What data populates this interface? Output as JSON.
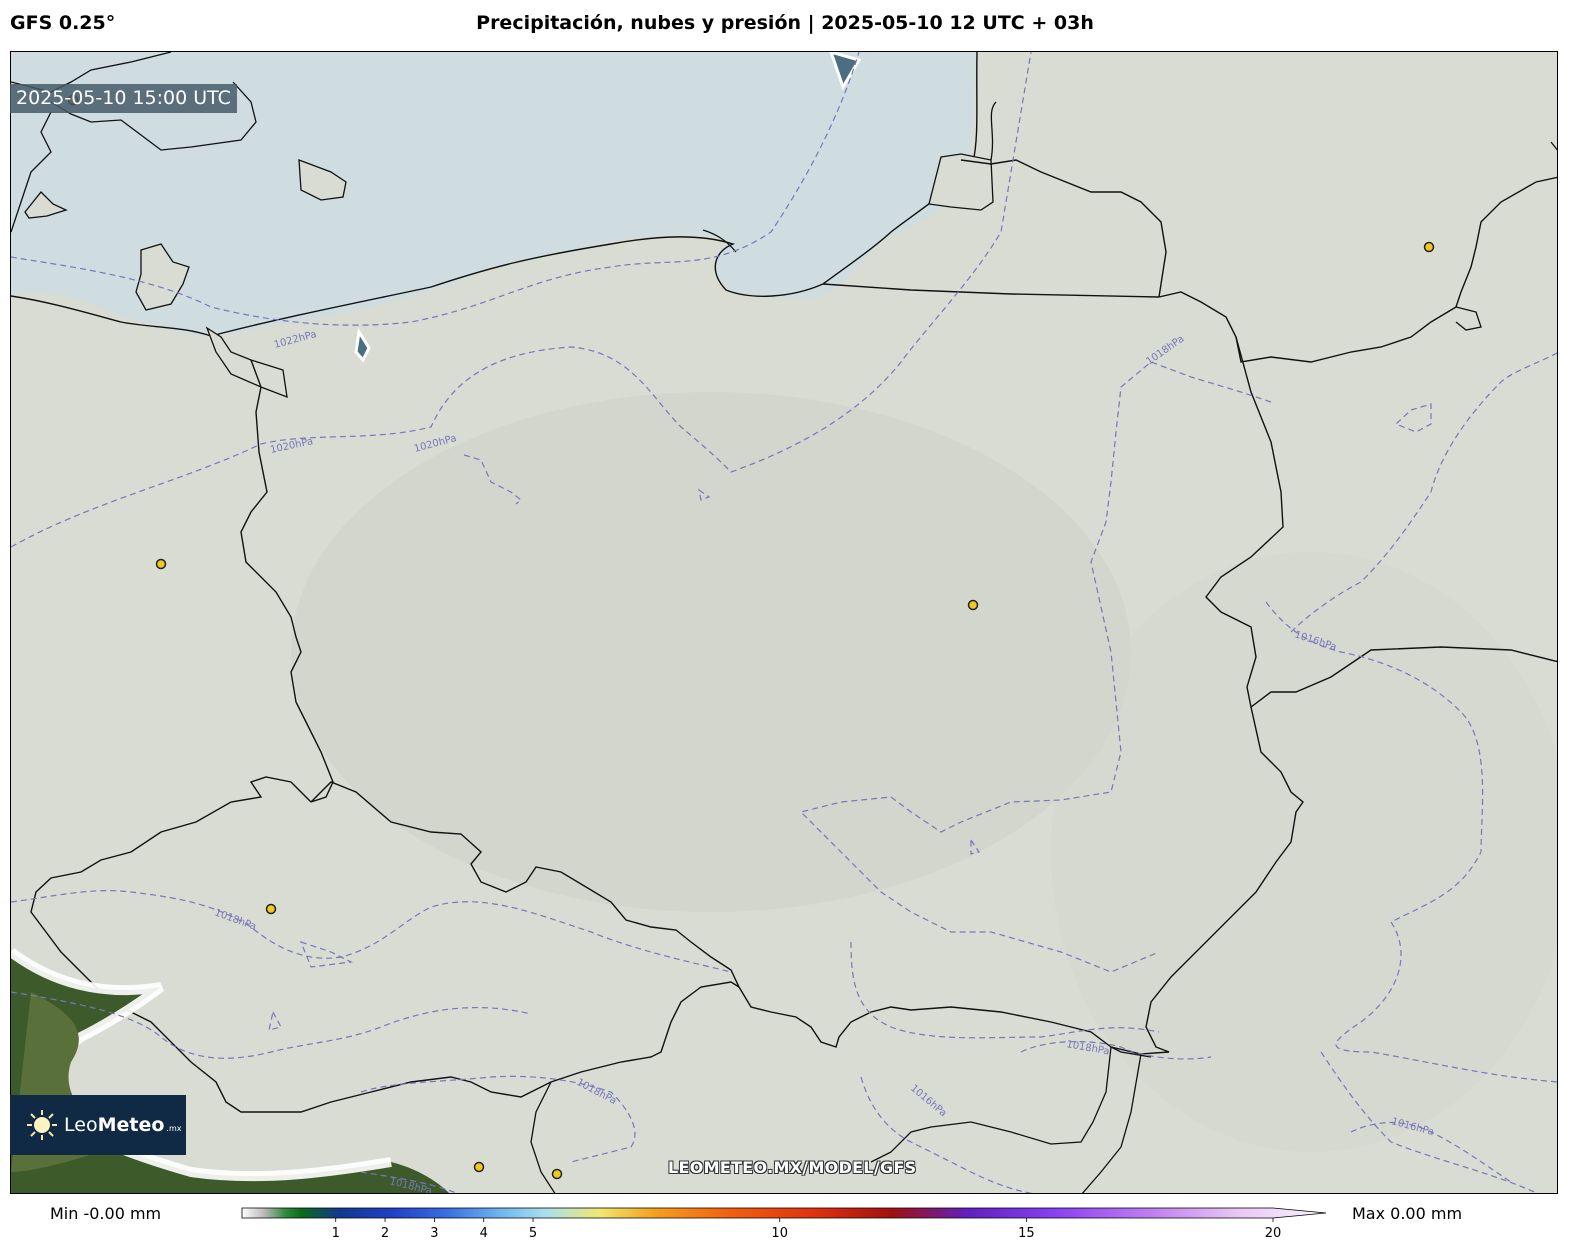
{
  "header": {
    "model": "GFS 0.25°",
    "title": "Precipitación, nubes y presión | 2025-05-10 12 UTC + 03h"
  },
  "map": {
    "valid_time": "2025-05-10 15:00 UTC",
    "isobar_labels": [
      "1022hPa",
      "1020hPa",
      "1020hPa",
      "1018hPa",
      "1016hPa",
      "1018hPa",
      "1018hPa",
      "1018hPa",
      "1016hPa",
      "1016hPa",
      "1018hPa"
    ],
    "colors": {
      "land": "#d8dcd2",
      "sea": "#cfdde0",
      "isobar": "#7777bb",
      "city_marker": "#f0c820"
    }
  },
  "logo": {
    "name_light": "Leo",
    "name_bold": "Meteo",
    "suffix": ".mx"
  },
  "watermark": "LEOMETEO.MX/MODEL/GFS",
  "legend": {
    "min": "Min -0.00 mm",
    "max": "Max 0.00 mm",
    "ticks": [
      "1",
      "2",
      "3",
      "4",
      "5",
      "10",
      "15",
      "20"
    ],
    "tick_values": [
      1,
      2,
      3,
      4,
      5,
      10,
      15,
      20
    ],
    "range": [
      -0.9,
      20
    ]
  }
}
